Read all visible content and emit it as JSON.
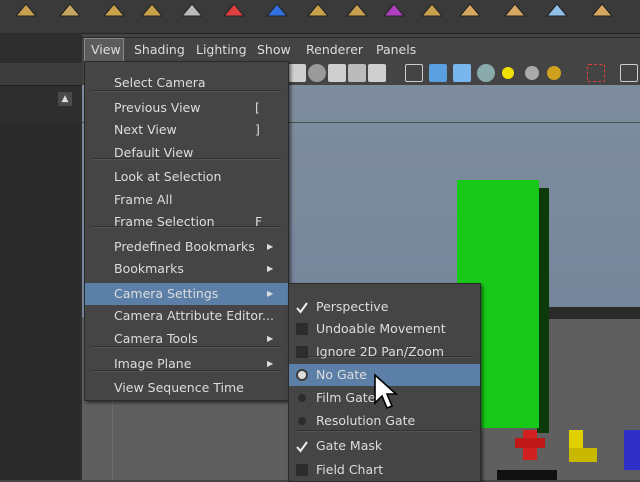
{
  "panel_menu": {
    "items": [
      "View",
      "Shading",
      "Lighting",
      "Show",
      "Renderer",
      "Panels"
    ]
  },
  "view_menu": {
    "items": [
      {
        "label": "Select Camera",
        "shortcut": "",
        "submenu": false
      },
      {
        "label": "Previous View",
        "shortcut": "[",
        "submenu": false
      },
      {
        "label": "Next View",
        "shortcut": "]",
        "submenu": false
      },
      {
        "label": "Default View",
        "shortcut": "",
        "submenu": false
      },
      {
        "label": "Look at Selection",
        "shortcut": "",
        "submenu": false
      },
      {
        "label": "Frame All",
        "shortcut": "",
        "submenu": false
      },
      {
        "label": "Frame Selection",
        "shortcut": "F",
        "submenu": false
      },
      {
        "label": "Predefined Bookmarks",
        "shortcut": "",
        "submenu": true
      },
      {
        "label": "Bookmarks",
        "shortcut": "",
        "submenu": true
      },
      {
        "label": "Camera Settings",
        "shortcut": "",
        "submenu": true,
        "highlighted": true
      },
      {
        "label": "Camera Attribute Editor...",
        "shortcut": "",
        "submenu": false
      },
      {
        "label": "Camera Tools",
        "shortcut": "",
        "submenu": true
      },
      {
        "label": "Image Plane",
        "shortcut": "",
        "submenu": true
      },
      {
        "label": "View Sequence Time",
        "shortcut": "",
        "submenu": false
      }
    ]
  },
  "camera_settings": {
    "items": [
      {
        "label": "Perspective",
        "control": "checkbox",
        "checked": true
      },
      {
        "label": "Undoable Movement",
        "control": "checkbox",
        "checked": false
      },
      {
        "label": "Ignore 2D Pan/Zoom",
        "control": "checkbox",
        "checked": false
      },
      {
        "label": "No Gate",
        "control": "radio",
        "checked": true,
        "highlighted": true
      },
      {
        "label": "Film Gate",
        "control": "radio",
        "checked": false
      },
      {
        "label": "Resolution Gate",
        "control": "radio",
        "checked": false
      },
      {
        "label": "Gate Mask",
        "control": "checkbox",
        "checked": true
      },
      {
        "label": "Field Chart",
        "control": "checkbox",
        "checked": false
      }
    ]
  },
  "shelf_icons": [
    "cube-icon",
    "pyramid-icon",
    "prism-icon",
    "cylinder-icon",
    "disc-icon",
    "magnet-icon",
    "curve-icon",
    "sphere-icon",
    "lattice-icon",
    "wireframe-cube-icon",
    "tent-icon",
    "arrow-icon",
    "plane-icon",
    "plane-icon",
    "plane-icon"
  ],
  "toolbar_icons": [
    "grid-icon",
    "sphere-shaded-icon",
    "wire-icon",
    "checker-icon",
    "texture-icon",
    "cube-wire-icon",
    "cube-shaded-icon",
    "cube-lit-icon",
    "checker-sphere-icon",
    "light-icon",
    "sphere-gray-icon",
    "sphere-gold-icon",
    "select-icon",
    "cube-outline-icon"
  ],
  "colors": {
    "highlight": "#5b7fa7",
    "menu_bg": "#454545",
    "green_box": "#19c919"
  }
}
